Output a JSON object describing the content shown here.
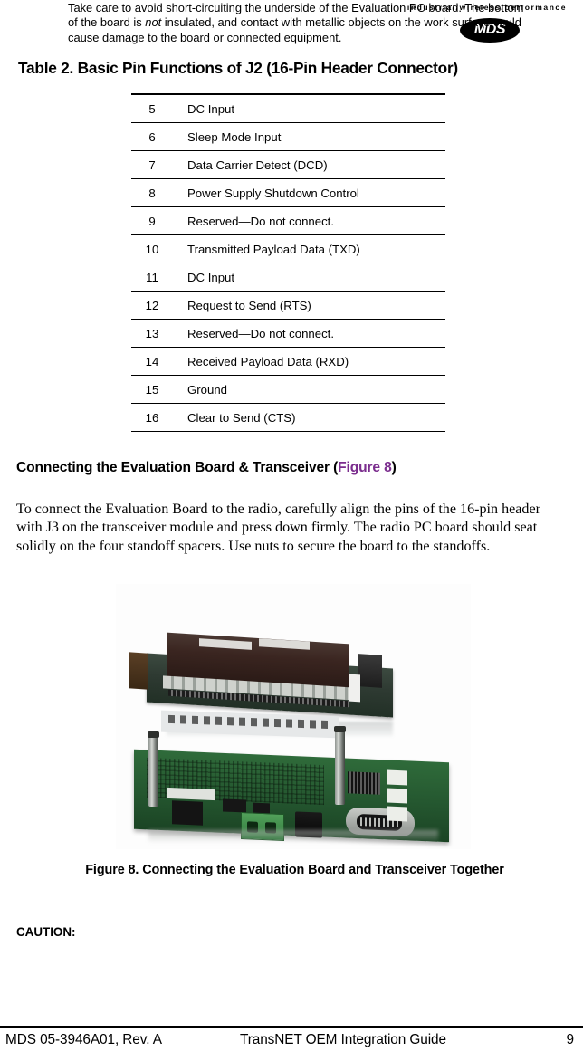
{
  "header": {
    "tagline": "industrial/wireless/performance",
    "logo_text": "MDS"
  },
  "table": {
    "title": "Table 2. Basic Pin Functions of J2 (16-Pin Header Connector)",
    "rows": [
      {
        "pin": "5",
        "function": "DC Input"
      },
      {
        "pin": "6",
        "function": "Sleep Mode Input"
      },
      {
        "pin": "7",
        "function": "Data Carrier Detect (DCD)"
      },
      {
        "pin": "8",
        "function": "Power Supply Shutdown Control"
      },
      {
        "pin": "9",
        "function": "Reserved—Do not connect."
      },
      {
        "pin": "10",
        "function": "Transmitted Payload Data (TXD)"
      },
      {
        "pin": "11",
        "function": "DC Input"
      },
      {
        "pin": "12",
        "function": "Request to Send (RTS)"
      },
      {
        "pin": "13",
        "function": "Reserved—Do not connect."
      },
      {
        "pin": "14",
        "function": "Received Payload Data (RXD)"
      },
      {
        "pin": "15",
        "function": "Ground"
      },
      {
        "pin": "16",
        "function": "Clear to Send (CTS)"
      }
    ]
  },
  "section": {
    "heading_main": "Connecting the Evaluation Board & Transceiver (",
    "heading_ref": "Figure 8",
    "heading_close": ")",
    "ref_color": "#7B2D8E",
    "paragraph": "To connect the Evaluation Board to the radio, carefully align the pins of the 16-pin header with J3 on the transceiver module and press down firmly. The radio PC board should seat solidly on the four standoff spacers. Use nuts to secure the board to the standoffs."
  },
  "figure": {
    "caption": "Figure 8. Connecting the Evaluation Board and Transceiver Together",
    "alt": "photo-of-evaluation-board-with-transceiver-module-mounted-on-standoffs"
  },
  "caution": {
    "label": "CAUTION:",
    "text_part1": "Take care to avoid short-circuiting the underside of the Evaluation PC board. The bottom of the board is ",
    "emphasis": "not",
    "text_part2": " insulated, and contact with metallic objects on the work surface could cause damage to the board or connected equipment."
  },
  "footer": {
    "left": "MDS 05-3946A01, Rev.  A",
    "center": "TransNET OEM Integration Guide",
    "page_number": "9"
  }
}
